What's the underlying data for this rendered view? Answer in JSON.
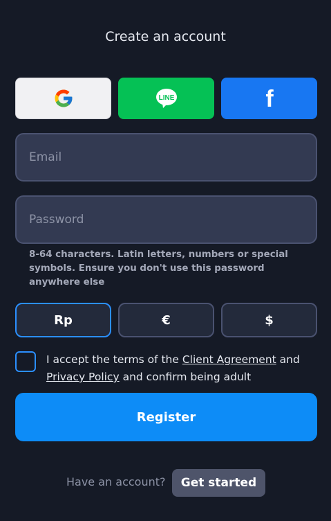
{
  "header": {
    "title": "Create an account"
  },
  "social": {
    "google_icon": "google-icon",
    "line_icon": "line-icon",
    "line_text": "LINE",
    "facebook_icon": "facebook-icon",
    "facebook_text": "f"
  },
  "form": {
    "email_placeholder": "Email",
    "password_placeholder": "Password",
    "password_hint": "8-64 characters. Latin letters, numbers or special symbols. Ensure you don't use this password anywhere else"
  },
  "currencies": {
    "items": [
      "Rp",
      "€",
      "$"
    ],
    "selected": "Rp"
  },
  "terms": {
    "prefix": "I accept the terms of the ",
    "client_agreement": "Client Agreement",
    "middle": " and ",
    "privacy_policy": "Privacy Policy",
    "suffix": " and confirm being adult",
    "checked": false
  },
  "register_label": "Register",
  "footer": {
    "have_account": "Have an account?",
    "get_started": "Get started"
  },
  "colors": {
    "background": "#151a26",
    "accent": "#0d8cf7",
    "line_green": "#05c155",
    "facebook_blue": "#1877f2"
  }
}
